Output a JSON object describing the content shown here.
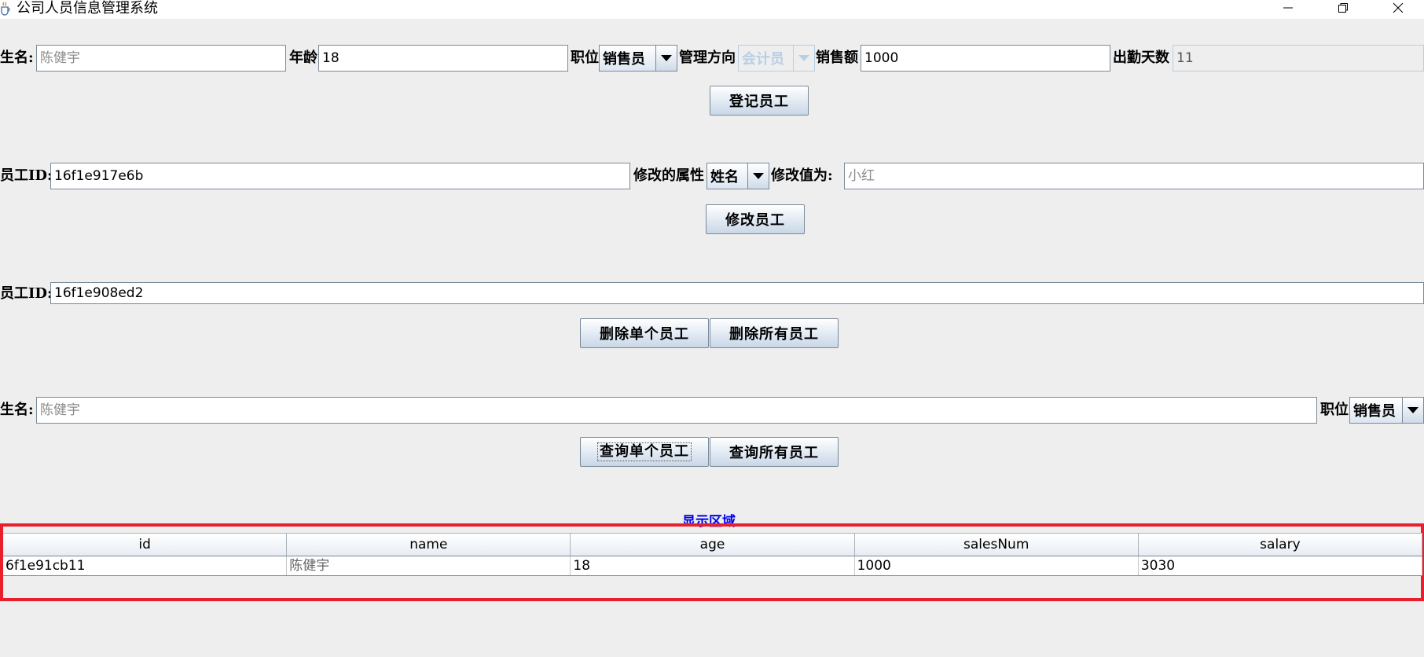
{
  "window": {
    "title": "公司人员信息管理系统",
    "app_icon": "java-cup-icon",
    "controls": [
      "minimize-icon",
      "restore-icon",
      "close-icon"
    ]
  },
  "register": {
    "name_label": "生名:",
    "name_value": "陈健宇",
    "age_label": "年龄",
    "age_value": "18",
    "position_label": "职位",
    "position_value": "销售员",
    "direction_label": "管理方向",
    "direction_value": "会计员",
    "sales_label": "销售额",
    "sales_value": "1000",
    "attendance_label": "出勤天数",
    "attendance_value": "11",
    "button": "登记员工"
  },
  "modify": {
    "id_label": "员工ID:",
    "id_value": "16f1e917e6b",
    "attr_label": "修改的属性",
    "attr_value": "姓名",
    "new_value_label": "修改值为:",
    "new_value": "小红",
    "button": "修改员工"
  },
  "delete": {
    "id_label": "员工ID:",
    "id_value": "16f1e908ed2",
    "button_single": "删除单个员工",
    "button_all": "删除所有员工"
  },
  "query": {
    "name_label": "生名:",
    "name_value": "陈健宇",
    "position_label": "职位",
    "position_value": "销售员",
    "button_single": "查询单个员工",
    "button_all": "查询所有员工"
  },
  "display": {
    "title": "显示区域",
    "columns": [
      "id",
      "name",
      "age",
      "salesNum",
      "salary"
    ],
    "rows": [
      [
        "6f1e91cb11",
        "陈健宇",
        "18",
        "1000",
        "3030"
      ]
    ]
  },
  "colors": {
    "background": "#eeeeee",
    "highlight_border": "#e8202e",
    "section_title": "#0000ee"
  }
}
